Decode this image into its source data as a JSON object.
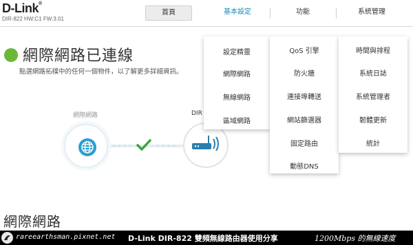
{
  "header": {
    "brand": "D-Link",
    "model": "DIR-822 HW:C1 FW:3.01",
    "nav": {
      "home": "首頁",
      "basic": "基本設定",
      "function": "功能",
      "system": "系統管理"
    }
  },
  "status": {
    "title": "網際網路已連線",
    "description": "點選網路拓樸中的任何一個物件，以了解更多詳細資訊。"
  },
  "diagram": {
    "internet_label": "網際網路",
    "router_label": "DIR"
  },
  "section_title": "網際網路",
  "menus": {
    "basic": [
      "設定精靈",
      "網際網路",
      "無線網路",
      "區域網路"
    ],
    "function": [
      "QoS 引擎",
      "防火牆",
      "連接埠轉送",
      "網站篩選器",
      "固定路由",
      "動態DNS"
    ],
    "system": [
      "時間與排程",
      "系統日誌",
      "系統管理者",
      "韌體更新",
      "統計"
    ]
  },
  "banner": {
    "url": "rareearthsman.pixnet.net",
    "title": "D-Link DIR-822 雙頻無線路由器使用分享",
    "speed": "1200Mbps 的無線速度"
  },
  "colors": {
    "status_green": "#6ab839",
    "accent_blue": "#1a8bb8",
    "globe_blue": "#2aa0d0",
    "check_green": "#3aa63a"
  }
}
